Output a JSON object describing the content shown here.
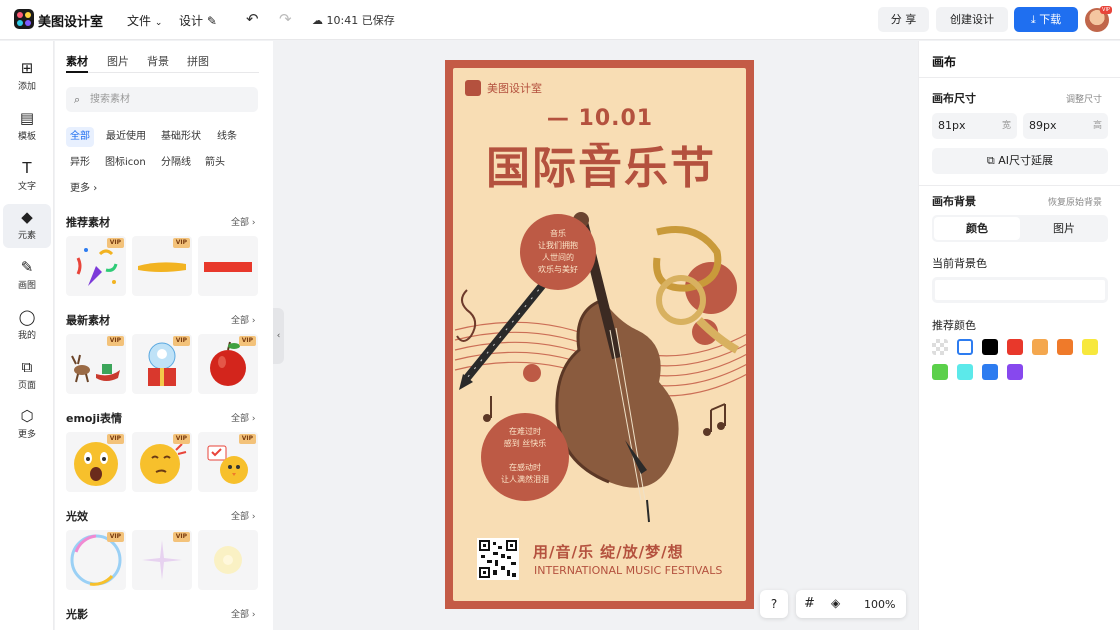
{
  "topbar": {
    "brand": "美图设计室",
    "menu_file": "文件",
    "menu_design": "设计",
    "saved_status": "10:41 已保存",
    "share": "分 享",
    "create_design": "创建设计",
    "download": "下载",
    "avatar_badge": "VIP"
  },
  "rail": {
    "items": [
      {
        "label": "添加",
        "icon": "plus-square-icon"
      },
      {
        "label": "模板",
        "icon": "template-icon"
      },
      {
        "label": "文字",
        "icon": "text-icon"
      },
      {
        "label": "元素",
        "icon": "shapes-icon"
      },
      {
        "label": "画图",
        "icon": "pen-icon"
      },
      {
        "label": "我的",
        "icon": "user-icon"
      },
      {
        "label": "页面",
        "icon": "page-add-icon"
      },
      {
        "label": "更多",
        "icon": "cube-icon"
      }
    ]
  },
  "left_panel": {
    "tabs": [
      "素材",
      "图片",
      "背景",
      "拼图"
    ],
    "search_placeholder": "搜索素材",
    "chips": [
      "全部",
      "最近使用",
      "基础形状",
      "线条",
      "异形",
      "图标icon",
      "分隔线",
      "箭头",
      "更多"
    ],
    "all_label": "全部",
    "vip_label": "VIP",
    "sections": [
      "推荐素材",
      "最新素材",
      "emoji表情",
      "光效",
      "光影"
    ]
  },
  "poster": {
    "brand": "美图设计室",
    "date": "10.01",
    "title": "国际音乐节",
    "bubble1": [
      "音乐",
      "让我们拥抱",
      "人世间的",
      "欢乐与美好"
    ],
    "bubble2": [
      "在难过时",
      "感到  丝快乐",
      "",
      "在感动时",
      "让人满然泪泪"
    ],
    "slogan": "用/音/乐  绽/放/梦/想",
    "english": "INTERNATIONAL MUSIC FESTIVALS"
  },
  "floatbar": {
    "help": "?",
    "zoom": "100%"
  },
  "right_panel": {
    "title": "画布",
    "size_label": "画布尺寸",
    "adjust_size": "调整尺寸",
    "width_value": "81px",
    "width_unit": "宽",
    "height_value": "89px",
    "height_unit": "高",
    "ai_extend": "AI尺寸延展",
    "bg_label": "画布背景",
    "restore_bg": "恢复原始背景",
    "seg_color": "颜色",
    "seg_image": "图片",
    "current_bg": "当前背景色",
    "recommended": "推荐颜色",
    "colors": [
      "transparent",
      "#ffffff",
      "#000000",
      "#e8382b",
      "#f4a74e",
      "#ef7a2a",
      "#f7e83d",
      "#5bd04a",
      "#5ce9ea",
      "#2d7cf0",
      "#8748ee"
    ]
  }
}
